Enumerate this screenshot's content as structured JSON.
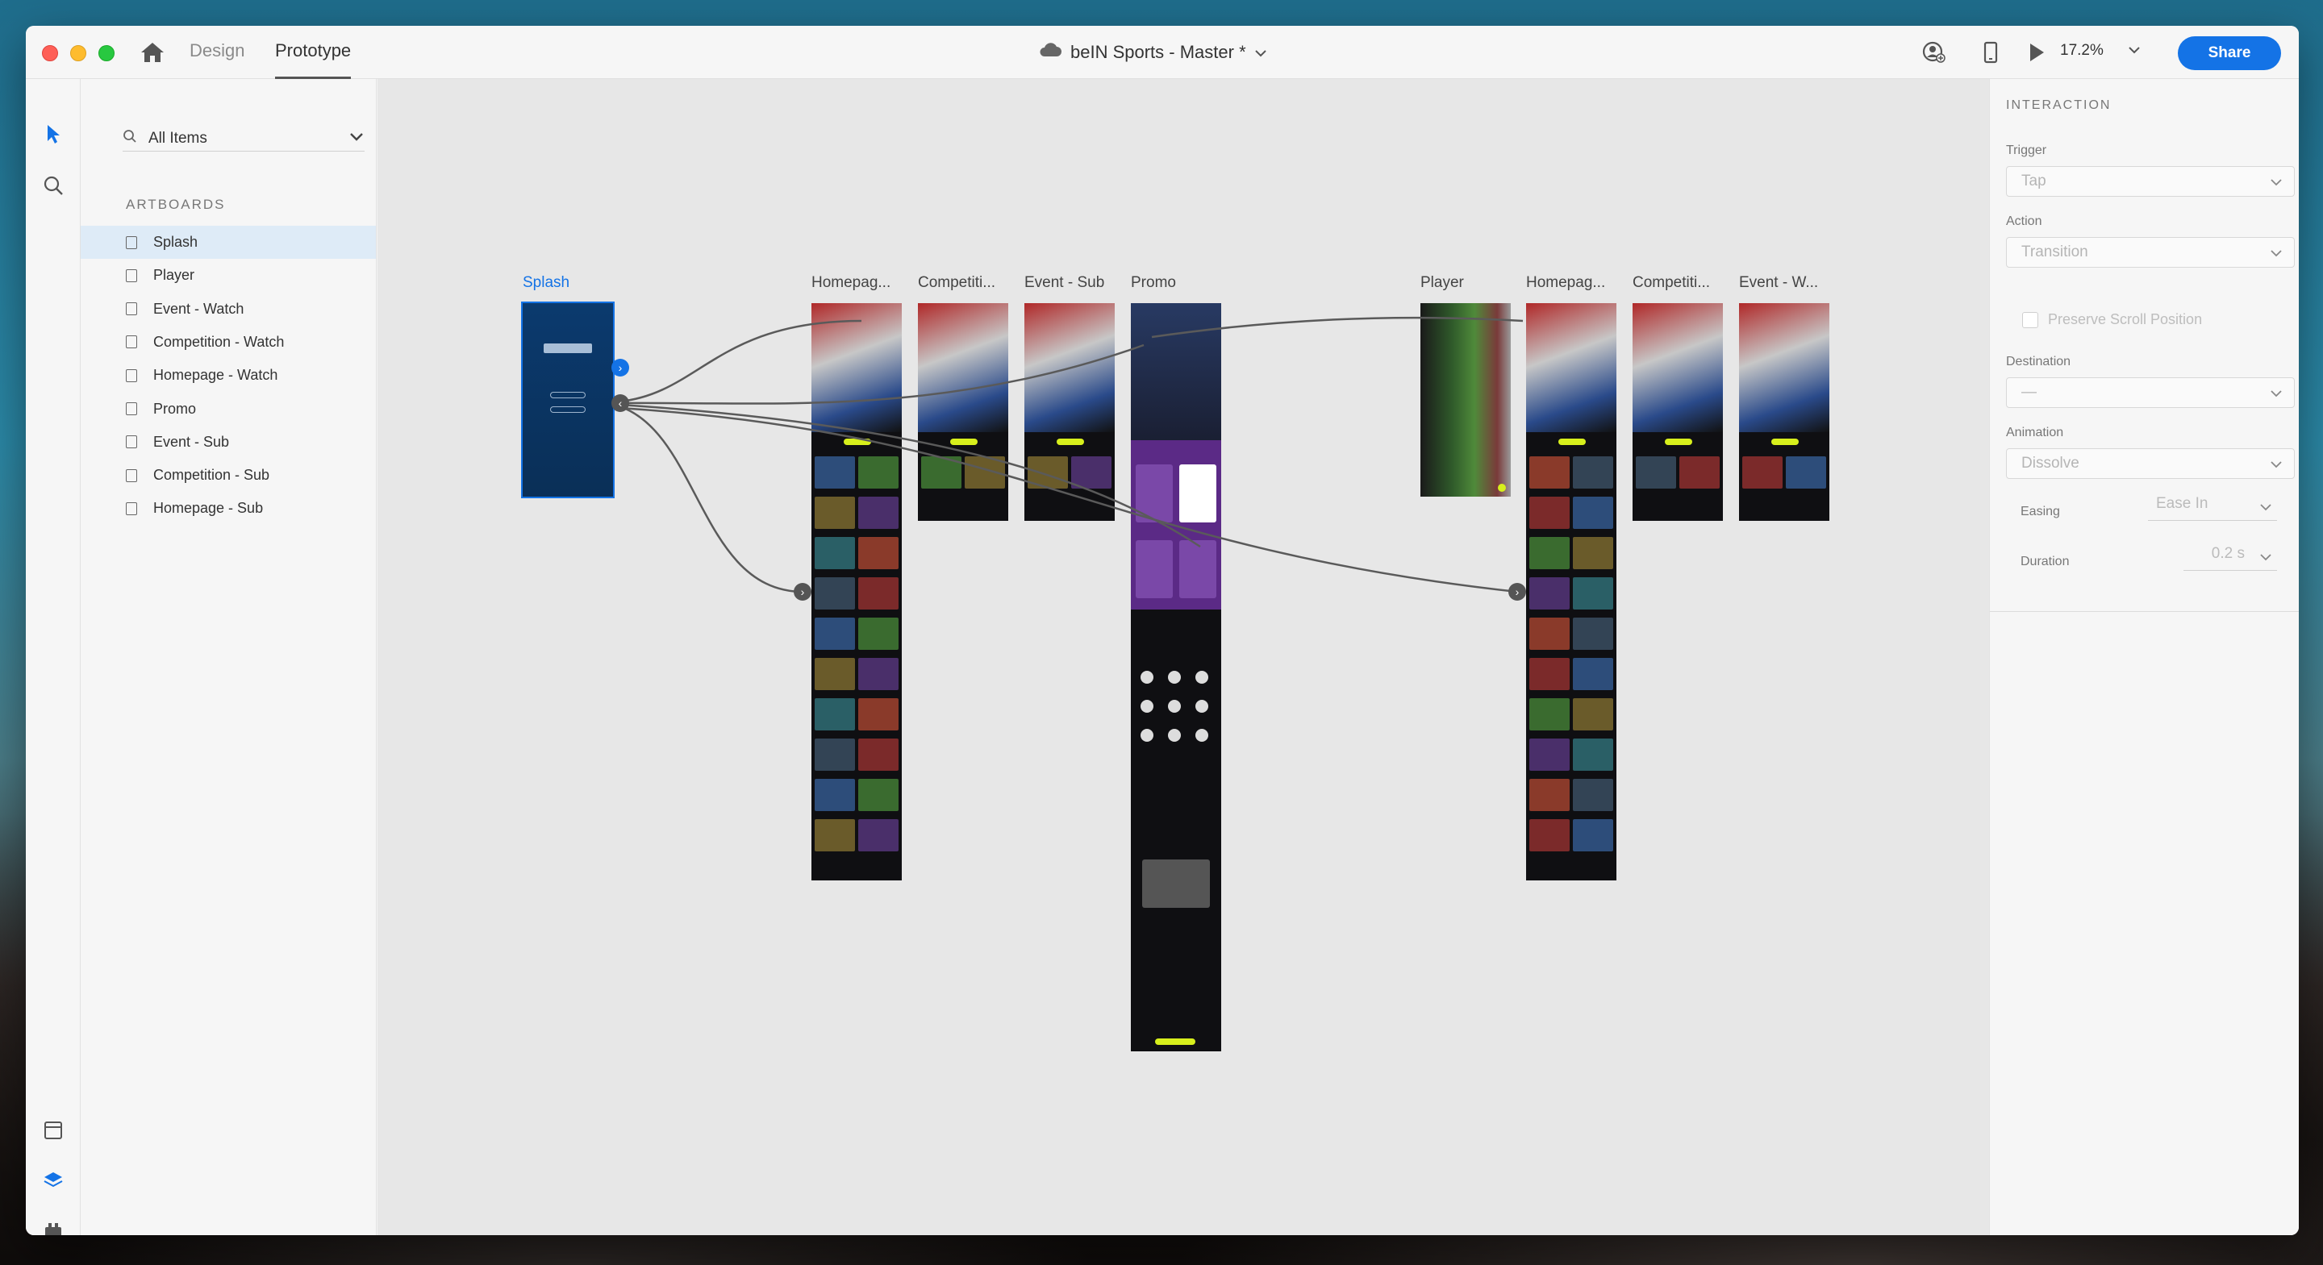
{
  "window": {
    "mode_tabs": [
      "Design",
      "Prototype"
    ],
    "active_mode": "Prototype",
    "doc_title": "beIN Sports - Master *",
    "zoom": "17.2%",
    "share_label": "Share"
  },
  "layers": {
    "filter": "All Items",
    "section_label": "ARTBOARDS",
    "items": [
      "Splash",
      "Player",
      "Event - Watch",
      "Competition - Watch",
      "Homepage - Watch",
      "Promo",
      "Event - Sub",
      "Competition - Sub",
      "Homepage - Sub"
    ],
    "selected": "Splash"
  },
  "canvas": {
    "artboards": [
      "Splash",
      "Homepag...",
      "Competiti...",
      "Event - Sub",
      "Promo",
      "Player",
      "Homepag...",
      "Competiti...",
      "Event - W..."
    ]
  },
  "interaction": {
    "header": "INTERACTION",
    "trigger_label": "Trigger",
    "trigger_value": "Tap",
    "action_label": "Action",
    "action_value": "Transition",
    "preserve_scroll_label": "Preserve Scroll Position",
    "destination_label": "Destination",
    "destination_value": "—",
    "animation_label": "Animation",
    "animation_value": "Dissolve",
    "easing_label": "Easing",
    "easing_value": "Ease In",
    "duration_label": "Duration",
    "duration_value": "0.2 s"
  },
  "colors": {
    "accent": "#1473e6",
    "board_bg": "#0f0f12",
    "promo_purple": "#5b2a86",
    "highlight_yellow": "#d7ef1c"
  }
}
